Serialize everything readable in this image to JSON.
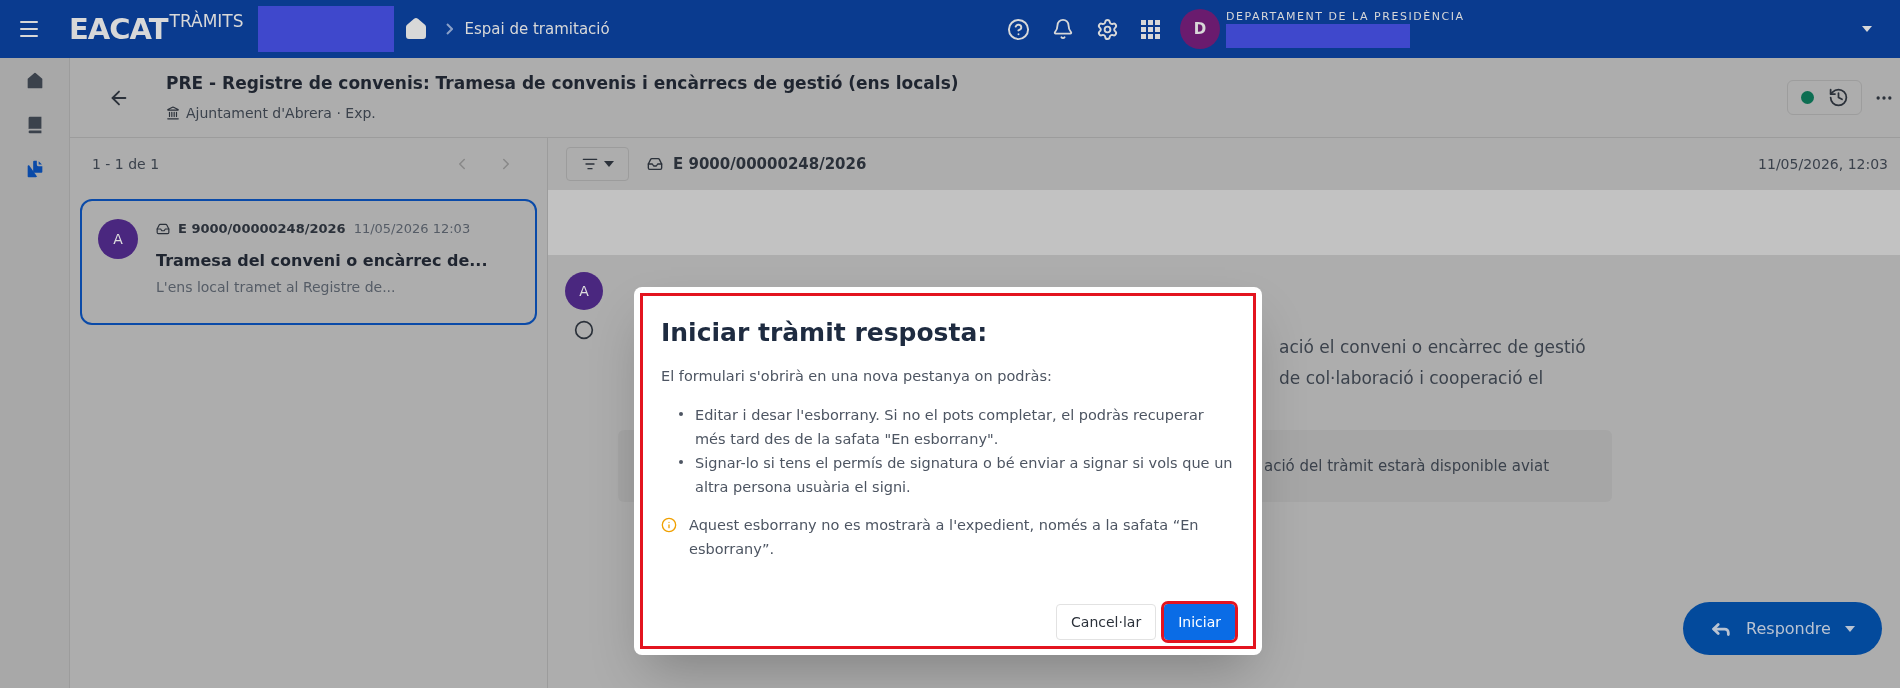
{
  "top_bar": {
    "logo": "EACAT",
    "logo_suffix": "TRÀMITS",
    "breadcrumb": "Espai de tramitació",
    "avatar": "D",
    "organization": "DEPARTAMENT DE LA PRESIDÈNCIA"
  },
  "side_nav": [
    {
      "kind": "home",
      "selected": false
    },
    {
      "kind": "book",
      "selected": false
    },
    {
      "kind": "files",
      "selected": true
    }
  ],
  "header": {
    "title": "PRE - Registre de convenis: Tramesa de convenis i encàrrecs de gestió (ens locals)",
    "subtitle": "Ajuntament d'Abrera · Exp."
  },
  "list": {
    "pagination": "1 - 1 de 1",
    "items": [
      {
        "avatar": "A",
        "code": "E 9000/00000248/2026",
        "date": "11/05/2026 12:03",
        "title": "Tramesa del conveni o encàrrec de...",
        "summary": "L'ens local tramet al Registre de...",
        "selected": true
      }
    ]
  },
  "detail": {
    "code": "E 9000/00000248/2026",
    "date": "11/05/2026, 12:03",
    "sender_avatar": "A",
    "body_lines": [
      "ació el conveni o encàrrec de gestió",
      "de col·laboració i cooperació el"
    ],
    "notice": "ació del tràmit estarà disponible aviat",
    "reply_button": "Respondre"
  },
  "dialog": {
    "title": "Iniciar tràmit resposta:",
    "intro": "El formulari s'obrirà en una nova pestanya on podràs:",
    "highlighted": true,
    "bullets": [
      "Editar i desar l'esborrany. Si no el pots completar, el podràs recuperar més tard des de la safata \"En esborrany\".",
      "Signar-lo si tens el permís de signatura o bé enviar a signar si vols que un altra persona usuària el signi."
    ],
    "warning": "Aquest esborrany no es mostrarà a l'expedient, només a la safata “En esborrany”.",
    "buttons": [
      {
        "label": "Cancel·lar",
        "kind": "secondary",
        "highlighted": false
      },
      {
        "label": "Iniciar",
        "kind": "primary",
        "highlighted": true
      }
    ]
  }
}
